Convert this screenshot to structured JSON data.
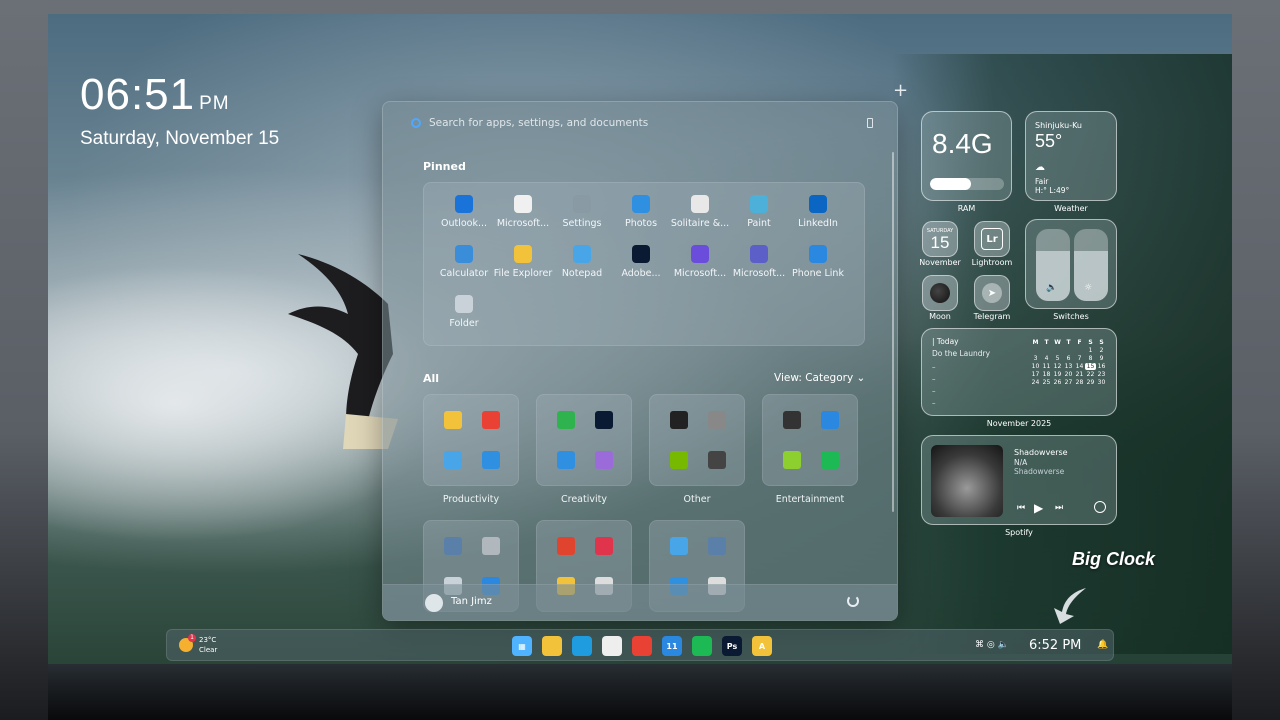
{
  "lock": {
    "time": "06:51",
    "ampm": "PM",
    "date": "Saturday, November 15"
  },
  "start_menu": {
    "search_placeholder": "Search for apps, settings, and documents",
    "pinned_label": "Pinned",
    "pinned": [
      {
        "label": "Outlook...",
        "icon": "outlook-icon",
        "color": "#1a73d9"
      },
      {
        "label": "Microsoft...",
        "icon": "microsoft-store-icon",
        "color": "#f0f0f0"
      },
      {
        "label": "Settings",
        "icon": "gear-icon",
        "color": "#8a9aa5"
      },
      {
        "label": "Photos",
        "icon": "photos-icon",
        "color": "#2f8fe0"
      },
      {
        "label": "Solitaire &...",
        "icon": "solitaire-icon",
        "color": "#e8e8e8"
      },
      {
        "label": "Paint",
        "icon": "paint-icon",
        "color": "#4cb0d8"
      },
      {
        "label": "LinkedIn",
        "icon": "linkedin-icon",
        "color": "#0a66c2"
      },
      {
        "label": "Calculator",
        "icon": "calculator-icon",
        "color": "#3a8ed9"
      },
      {
        "label": "File Explorer",
        "icon": "folder-icon",
        "color": "#f2c33a"
      },
      {
        "label": "Notepad",
        "icon": "notepad-icon",
        "color": "#48a6e8"
      },
      {
        "label": "Adobe...",
        "icon": "photoshop-icon",
        "color": "#0b1a33"
      },
      {
        "label": "Microsoft...",
        "icon": "m365-icon",
        "color": "#6b4ddb"
      },
      {
        "label": "Microsoft...",
        "icon": "teams-icon",
        "color": "#5b5fc7"
      },
      {
        "label": "Phone Link",
        "icon": "phone-link-icon",
        "color": "#2a88e0"
      },
      {
        "label": "Folder",
        "icon": "folder-group-icon",
        "color": "#c9d2d8"
      }
    ],
    "all_label": "All",
    "view_label": "View: Category",
    "categories": [
      {
        "label": "Productivity",
        "colors": [
          "#f2c33a",
          "#e94235",
          "#48a6e8",
          "#2f8fe0"
        ]
      },
      {
        "label": "Creativity",
        "colors": [
          "#2fb34f",
          "#0b1a33",
          "#2f8fe0",
          "#9b6bd9"
        ]
      },
      {
        "label": "Other",
        "colors": [
          "#222",
          "#888",
          "#76b900",
          "#444"
        ]
      },
      {
        "label": "Entertainment",
        "colors": [
          "#333",
          "#2a88e0",
          "#8ccf2e",
          "#1db954"
        ]
      },
      {
        "label": "",
        "colors": [
          "#5a7fa8",
          "#b0b8bd",
          "#c9d2d8",
          "#2a88e0"
        ]
      },
      {
        "label": "",
        "colors": [
          "#e0442e",
          "#e0344c",
          "#f2c33a",
          "#ddd"
        ]
      },
      {
        "label": "",
        "colors": [
          "#48a6e8",
          "#5a7fa8",
          "#2f8fe0",
          "#ddd"
        ]
      }
    ],
    "user_name": "Tan Jimz"
  },
  "widgets": {
    "ram": {
      "value": "8.4G",
      "label": "RAM",
      "fraction": 0.55
    },
    "weather": {
      "location": "Shinjuku-Ku",
      "temp": "55°",
      "condition": "Fair",
      "hilo": "H:° L:49°",
      "label": "Weather"
    },
    "calendar_small": {
      "dow": "SATURDAY",
      "day": "15",
      "label": "November"
    },
    "lightroom": {
      "glyph": "Lr",
      "label": "Lightroom"
    },
    "moon": {
      "label": "Moon"
    },
    "telegram": {
      "label": "Telegram"
    },
    "switches": {
      "label": "Switches",
      "volume": 0.7,
      "brightness": 0.7
    },
    "calendar": {
      "today_label": "| Today",
      "task": "Do the Laundry",
      "days_header": [
        "M",
        "T",
        "W",
        "T",
        "F",
        "S",
        "S"
      ],
      "rows": [
        [
          "",
          "",
          "",
          "",
          "",
          "1",
          "2"
        ],
        [
          "3",
          "4",
          "5",
          "6",
          "7",
          "8",
          "9"
        ],
        [
          "10",
          "11",
          "12",
          "13",
          "14",
          "15",
          "16"
        ],
        [
          "17",
          "18",
          "19",
          "20",
          "21",
          "22",
          "23"
        ],
        [
          "24",
          "25",
          "26",
          "27",
          "28",
          "29",
          "30"
        ]
      ],
      "highlight": "15",
      "label": "November 2025"
    },
    "spotify": {
      "title": "Shadowverse",
      "artist": "N/A",
      "album": "Shadowverse",
      "label": "Spotify"
    }
  },
  "annotation": {
    "big_clock": "Big Clock"
  },
  "taskbar": {
    "weather_temp": "23°C",
    "weather_cond": "Clear",
    "weather_badge": "1",
    "apps": [
      {
        "name": "start-button",
        "color": "#4fb3ff",
        "glyph": "▦"
      },
      {
        "name": "file-explorer-taskbar",
        "color": "#f2c33a",
        "glyph": ""
      },
      {
        "name": "edge-taskbar",
        "color": "#1f9be0",
        "glyph": ""
      },
      {
        "name": "store-taskbar",
        "color": "#eeeeee",
        "glyph": ""
      },
      {
        "name": "chrome-taskbar",
        "color": "#e94235",
        "glyph": ""
      },
      {
        "name": "updates-taskbar",
        "color": "#2a88e0",
        "glyph": "11"
      },
      {
        "name": "spotify-taskbar",
        "color": "#1db954",
        "glyph": ""
      },
      {
        "name": "photoshop-taskbar",
        "color": "#0b1a33",
        "glyph": "Ps"
      },
      {
        "name": "app-taskbar",
        "color": "#f2c33a",
        "glyph": "A"
      }
    ],
    "clock": "6:52 PM"
  }
}
